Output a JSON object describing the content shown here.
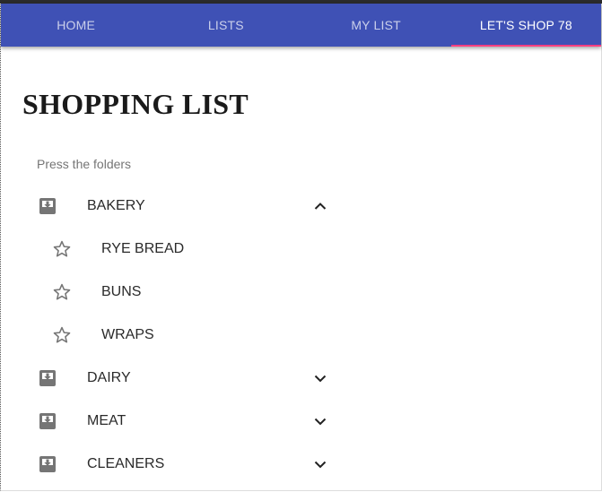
{
  "nav": {
    "tabs": [
      {
        "label": "HOME",
        "active": false
      },
      {
        "label": "LISTS",
        "active": false
      },
      {
        "label": "MY LIST",
        "active": false
      },
      {
        "label": "LET'S SHOP 78",
        "active": true
      }
    ]
  },
  "page": {
    "title": "SHOPPING LIST",
    "hint": "Press the folders"
  },
  "folders": [
    {
      "label": "BAKERY",
      "expanded": true,
      "items": [
        {
          "label": "RYE BREAD",
          "icon": "star-outline-icon"
        },
        {
          "label": "BUNS",
          "icon": "star-outline-icon"
        },
        {
          "label": "WRAPS",
          "icon": "star-outline-icon"
        }
      ]
    },
    {
      "label": "DAIRY",
      "expanded": false
    },
    {
      "label": "MEAT",
      "expanded": false
    },
    {
      "label": "CLEANERS",
      "expanded": false
    }
  ],
  "colors": {
    "nav_bg": "#3f51b5",
    "tab_indicator": "#ff4081",
    "icon_gray": "#757575"
  }
}
